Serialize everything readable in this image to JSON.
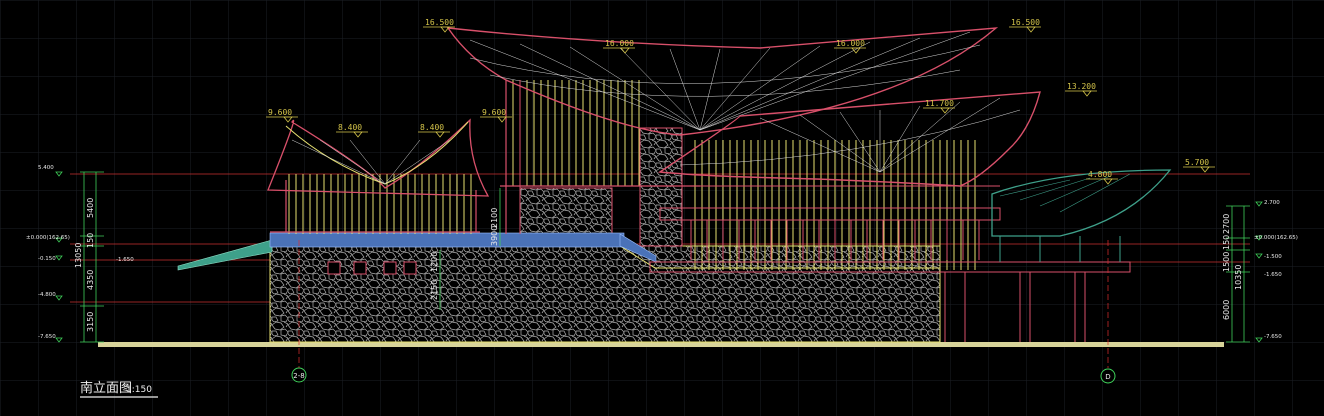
{
  "drawing": {
    "title": "南立面图",
    "scale": "1:150"
  },
  "elevations": [
    "16.500",
    "16.000",
    "16.000",
    "16.500",
    "9.600",
    "8.400",
    "8.400",
    "9.600",
    "11.700",
    "13.200",
    "4.800",
    "5.700"
  ],
  "left_levels": [
    "5.400",
    "±0.000(162.65)",
    "-0.150",
    "-1.650",
    "-4.800",
    "-7.650"
  ],
  "left_dims": [
    "5400",
    "150",
    "4350",
    "3150",
    "13050"
  ],
  "right_levels": [
    "2.700",
    "±0.000(162.65)",
    "-1.500",
    "-1.650",
    "-7.650"
  ],
  "right_dims": [
    "2700",
    "150",
    "1500",
    "6000",
    "10350"
  ],
  "middle_dims": [
    "2100",
    "3900",
    "1200",
    "2150"
  ],
  "grid_axes": [
    "2-8",
    "D"
  ],
  "colors": {
    "background": "#000000",
    "roof_red": "#d8506a",
    "roof_lines": "#d8d8d8",
    "columns_yellow": "#e6e070",
    "stone_gray": "#a8a8a8",
    "platform_blue": "#4a72b8",
    "pavilion_teal": "#3ea08a",
    "ground_line": "#e8e4a0",
    "dim_green": "#3fd05a",
    "axis_red": "#e03030"
  }
}
